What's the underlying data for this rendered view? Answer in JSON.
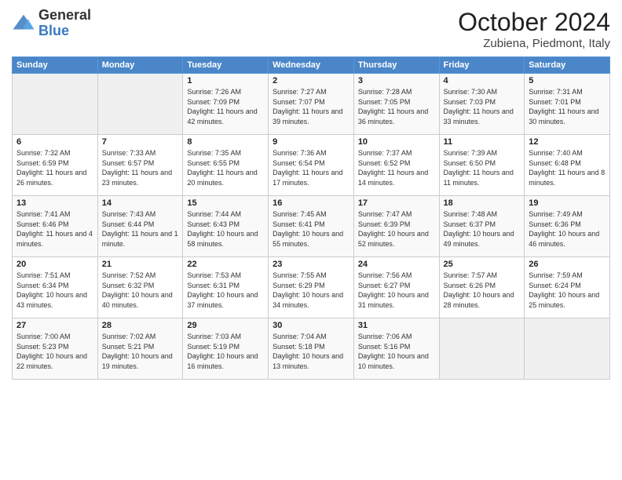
{
  "header": {
    "logo_general": "General",
    "logo_blue": "Blue",
    "month_title": "October 2024",
    "location": "Zubiena, Piedmont, Italy"
  },
  "days_of_week": [
    "Sunday",
    "Monday",
    "Tuesday",
    "Wednesday",
    "Thursday",
    "Friday",
    "Saturday"
  ],
  "weeks": [
    [
      {
        "day": "",
        "info": ""
      },
      {
        "day": "",
        "info": ""
      },
      {
        "day": "1",
        "info": "Sunrise: 7:26 AM\nSunset: 7:09 PM\nDaylight: 11 hours and 42 minutes."
      },
      {
        "day": "2",
        "info": "Sunrise: 7:27 AM\nSunset: 7:07 PM\nDaylight: 11 hours and 39 minutes."
      },
      {
        "day": "3",
        "info": "Sunrise: 7:28 AM\nSunset: 7:05 PM\nDaylight: 11 hours and 36 minutes."
      },
      {
        "day": "4",
        "info": "Sunrise: 7:30 AM\nSunset: 7:03 PM\nDaylight: 11 hours and 33 minutes."
      },
      {
        "day": "5",
        "info": "Sunrise: 7:31 AM\nSunset: 7:01 PM\nDaylight: 11 hours and 30 minutes."
      }
    ],
    [
      {
        "day": "6",
        "info": "Sunrise: 7:32 AM\nSunset: 6:59 PM\nDaylight: 11 hours and 26 minutes."
      },
      {
        "day": "7",
        "info": "Sunrise: 7:33 AM\nSunset: 6:57 PM\nDaylight: 11 hours and 23 minutes."
      },
      {
        "day": "8",
        "info": "Sunrise: 7:35 AM\nSunset: 6:55 PM\nDaylight: 11 hours and 20 minutes."
      },
      {
        "day": "9",
        "info": "Sunrise: 7:36 AM\nSunset: 6:54 PM\nDaylight: 11 hours and 17 minutes."
      },
      {
        "day": "10",
        "info": "Sunrise: 7:37 AM\nSunset: 6:52 PM\nDaylight: 11 hours and 14 minutes."
      },
      {
        "day": "11",
        "info": "Sunrise: 7:39 AM\nSunset: 6:50 PM\nDaylight: 11 hours and 11 minutes."
      },
      {
        "day": "12",
        "info": "Sunrise: 7:40 AM\nSunset: 6:48 PM\nDaylight: 11 hours and 8 minutes."
      }
    ],
    [
      {
        "day": "13",
        "info": "Sunrise: 7:41 AM\nSunset: 6:46 PM\nDaylight: 11 hours and 4 minutes."
      },
      {
        "day": "14",
        "info": "Sunrise: 7:43 AM\nSunset: 6:44 PM\nDaylight: 11 hours and 1 minute."
      },
      {
        "day": "15",
        "info": "Sunrise: 7:44 AM\nSunset: 6:43 PM\nDaylight: 10 hours and 58 minutes."
      },
      {
        "day": "16",
        "info": "Sunrise: 7:45 AM\nSunset: 6:41 PM\nDaylight: 10 hours and 55 minutes."
      },
      {
        "day": "17",
        "info": "Sunrise: 7:47 AM\nSunset: 6:39 PM\nDaylight: 10 hours and 52 minutes."
      },
      {
        "day": "18",
        "info": "Sunrise: 7:48 AM\nSunset: 6:37 PM\nDaylight: 10 hours and 49 minutes."
      },
      {
        "day": "19",
        "info": "Sunrise: 7:49 AM\nSunset: 6:36 PM\nDaylight: 10 hours and 46 minutes."
      }
    ],
    [
      {
        "day": "20",
        "info": "Sunrise: 7:51 AM\nSunset: 6:34 PM\nDaylight: 10 hours and 43 minutes."
      },
      {
        "day": "21",
        "info": "Sunrise: 7:52 AM\nSunset: 6:32 PM\nDaylight: 10 hours and 40 minutes."
      },
      {
        "day": "22",
        "info": "Sunrise: 7:53 AM\nSunset: 6:31 PM\nDaylight: 10 hours and 37 minutes."
      },
      {
        "day": "23",
        "info": "Sunrise: 7:55 AM\nSunset: 6:29 PM\nDaylight: 10 hours and 34 minutes."
      },
      {
        "day": "24",
        "info": "Sunrise: 7:56 AM\nSunset: 6:27 PM\nDaylight: 10 hours and 31 minutes."
      },
      {
        "day": "25",
        "info": "Sunrise: 7:57 AM\nSunset: 6:26 PM\nDaylight: 10 hours and 28 minutes."
      },
      {
        "day": "26",
        "info": "Sunrise: 7:59 AM\nSunset: 6:24 PM\nDaylight: 10 hours and 25 minutes."
      }
    ],
    [
      {
        "day": "27",
        "info": "Sunrise: 7:00 AM\nSunset: 5:23 PM\nDaylight: 10 hours and 22 minutes."
      },
      {
        "day": "28",
        "info": "Sunrise: 7:02 AM\nSunset: 5:21 PM\nDaylight: 10 hours and 19 minutes."
      },
      {
        "day": "29",
        "info": "Sunrise: 7:03 AM\nSunset: 5:19 PM\nDaylight: 10 hours and 16 minutes."
      },
      {
        "day": "30",
        "info": "Sunrise: 7:04 AM\nSunset: 5:18 PM\nDaylight: 10 hours and 13 minutes."
      },
      {
        "day": "31",
        "info": "Sunrise: 7:06 AM\nSunset: 5:16 PM\nDaylight: 10 hours and 10 minutes."
      },
      {
        "day": "",
        "info": ""
      },
      {
        "day": "",
        "info": ""
      }
    ]
  ]
}
